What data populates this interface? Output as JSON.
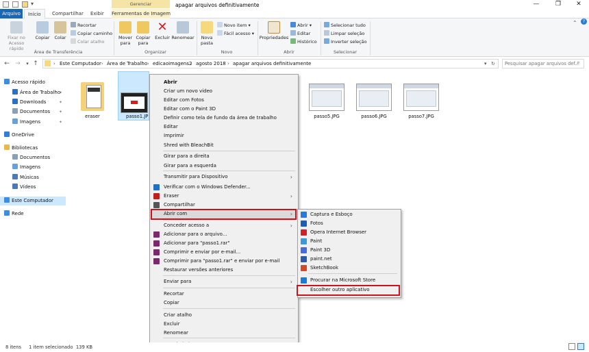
{
  "window": {
    "title": "apagar arquivos definitivamente",
    "context_tab_header": "Gerenciar",
    "controls": {
      "minimize": "—",
      "maximize": "❐",
      "close": "✕"
    }
  },
  "tabs": [
    {
      "label": "Arquivo"
    },
    {
      "label": "Início"
    },
    {
      "label": "Compartilhar"
    },
    {
      "label": "Exibir"
    },
    {
      "label": "Ferramentas de Imagem"
    }
  ],
  "ribbon": {
    "clipboard": {
      "pin": "Fixar no\nAcesso rápido",
      "copy": "Copiar",
      "paste": "Colar",
      "cut": "Recortar",
      "copy_path": "Copiar caminho",
      "paste_shortcut": "Colar atalho",
      "label": "Área de Transferência"
    },
    "organize": {
      "move": "Mover\npara",
      "copy_to": "Copiar\npara",
      "delete": "Excluir",
      "rename": "Renomear",
      "label": "Organizar"
    },
    "new": {
      "new_folder": "Nova\npasta",
      "new_item": "Novo item",
      "easy_access": "Fácil acesso",
      "label": "Novo"
    },
    "open": {
      "properties": "Propriedades",
      "open": "Abrir",
      "edit": "Editar",
      "history": "Histórico",
      "label": "Abrir"
    },
    "select": {
      "select_all": "Selecionar tudo",
      "clear_selection": "Limpar seleção",
      "invert_selection": "Inverter seleção",
      "label": "Selecionar"
    }
  },
  "address": {
    "crumbs": [
      "Este Computador",
      "Área de Trabalho",
      "edicaoimagens2",
      "agosto 2018",
      "apagar arquivos definitivamente"
    ],
    "search_placeholder": "Pesquisar apagar arquivos def..."
  },
  "sidebar": [
    {
      "label": "Acesso rápido",
      "icon": "star-icon",
      "color": "#3c8fe0"
    },
    {
      "label": "Área de Trabalho",
      "icon": "desktop-icon",
      "color": "#2f6fc0"
    },
    {
      "label": "Downloads",
      "icon": "download-icon",
      "color": "#2f6fc0"
    },
    {
      "label": "Documentos",
      "icon": "document-icon",
      "color": "#8aa0b8"
    },
    {
      "label": "Imagens",
      "icon": "image-icon",
      "color": "#6aa0d8"
    },
    {
      "label": "OneDrive",
      "icon": "cloud-icon",
      "color": "#2f7fd6"
    },
    {
      "label": "Bibliotecas",
      "icon": "library-icon",
      "color": "#e8b84a"
    },
    {
      "label": "Documentos",
      "icon": "document-icon",
      "color": "#8aa0b8"
    },
    {
      "label": "Imagens",
      "icon": "image-icon",
      "color": "#6aa0d8"
    },
    {
      "label": "Músicas",
      "icon": "music-icon",
      "color": "#4a7ab8"
    },
    {
      "label": "Vídeos",
      "icon": "video-icon",
      "color": "#4a7ab8"
    },
    {
      "label": "Este Computador",
      "icon": "computer-icon",
      "color": "#3c8fe0"
    },
    {
      "label": "Rede",
      "icon": "network-icon",
      "color": "#3c8fe0"
    }
  ],
  "files": [
    {
      "name": "eraser"
    },
    {
      "name": "passo1.JP"
    },
    {
      "name": "passo5.JPG"
    },
    {
      "name": "passo6.JPG"
    },
    {
      "name": "passo7.JPG"
    }
  ],
  "context_menu": [
    {
      "label": "Abrir",
      "bold": true
    },
    {
      "label": "Criar um novo vídeo"
    },
    {
      "label": "Editar com Fotos"
    },
    {
      "label": "Editar com o Paint 3D"
    },
    {
      "label": "Definir como tela de fundo da área de trabalho"
    },
    {
      "label": "Editar"
    },
    {
      "label": "Imprimir"
    },
    {
      "label": "Shred with BleachBit"
    },
    {
      "label": "Girar para a direita"
    },
    {
      "label": "Girar para a esquerda"
    },
    {
      "label": "Transmitir para Dispositivo",
      "submenu": true
    },
    {
      "label": "Verificar com o Windows Defender...",
      "icon": "defender-icon",
      "color": "#1f6fc5"
    },
    {
      "label": "Eraser",
      "icon": "eraser-icon",
      "color": "#c02020",
      "submenu": true
    },
    {
      "label": "Compartilhar",
      "icon": "share-icon",
      "color": "#555555"
    },
    {
      "label": "Abrir com",
      "submenu": true
    },
    {
      "label": "Conceder acesso a",
      "submenu": true
    },
    {
      "label": "Adicionar para o arquivo...",
      "icon": "winrar-icon",
      "color": "#7a2a6a"
    },
    {
      "label": "Adicionar para \"passo1.rar\"",
      "icon": "winrar-icon",
      "color": "#7a2a6a"
    },
    {
      "label": "Comprimir e enviar por e-mail...",
      "icon": "winrar-icon",
      "color": "#7a2a6a"
    },
    {
      "label": "Comprimir para \"passo1.rar\" e enviar por e-mail",
      "icon": "winrar-icon",
      "color": "#7a2a6a"
    },
    {
      "label": "Restaurar versões anteriores"
    },
    {
      "label": "Enviar para",
      "submenu": true
    },
    {
      "label": "Recortar"
    },
    {
      "label": "Copiar"
    },
    {
      "label": "Criar atalho"
    },
    {
      "label": "Excluir"
    },
    {
      "label": "Renomear"
    },
    {
      "label": "Propriedades"
    }
  ],
  "submenu": [
    {
      "label": "Captura e Esboço",
      "icon": "snip-icon",
      "color": "#2a7ad8"
    },
    {
      "label": "Fotos",
      "icon": "photos-icon",
      "color": "#1a5fb4"
    },
    {
      "label": "Opera Internet Browser",
      "icon": "opera-icon",
      "color": "#d0202a"
    },
    {
      "label": "Paint",
      "icon": "paint-icon",
      "color": "#3a9ad8"
    },
    {
      "label": "Paint 3D",
      "icon": "paint3d-icon",
      "color": "#4a6ad8"
    },
    {
      "label": "paint.net",
      "icon": "paintnet-icon",
      "color": "#2a5aa8"
    },
    {
      "label": "SketchBook",
      "icon": "sketchbook-icon",
      "color": "#d04a2a"
    },
    {
      "label": "Procurar na Microsoft Store",
      "icon": "store-icon",
      "color": "#1a7ad8"
    },
    {
      "label": "Escolher outro aplicativo"
    }
  ],
  "status": {
    "count": "8 itens",
    "selected": "1 item selecionado  139 KB"
  },
  "accent": "#d0101a"
}
